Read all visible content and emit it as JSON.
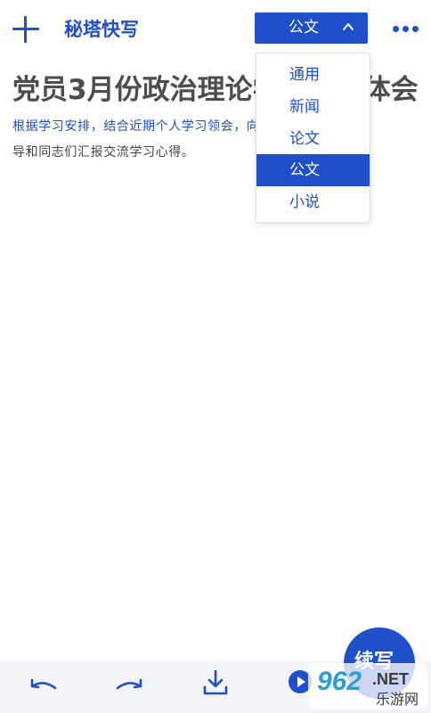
{
  "header": {
    "title": "秘塔快写",
    "mode_selected": "公文"
  },
  "dropdown": {
    "options": [
      "通用",
      "新闻",
      "论文",
      "公文",
      "小说"
    ],
    "selected": "公文"
  },
  "document": {
    "title": "党员3月份政治理论学习心得体会",
    "body_visible_start": "根据学习安排，结合近期个人学习领",
    "body_hidden_gap": "会，向各位领",
    "body_visible_end": "导和同志们汇报交流学习心得。"
  },
  "actions": {
    "continue_label": "续写"
  },
  "watermark": {
    "text_main": "962",
    "text_net": ".NET",
    "text_sub": "乐游网"
  },
  "colors": {
    "accent": "#1f4fc9",
    "title_text": "#4d4d4d",
    "body_text": "#444444",
    "bottom_bar": "#f3f4f7"
  },
  "icons": [
    "add-icon",
    "chevron-up-icon",
    "more-icon",
    "undo-icon",
    "redo-icon",
    "download-icon",
    "play-icon"
  ]
}
